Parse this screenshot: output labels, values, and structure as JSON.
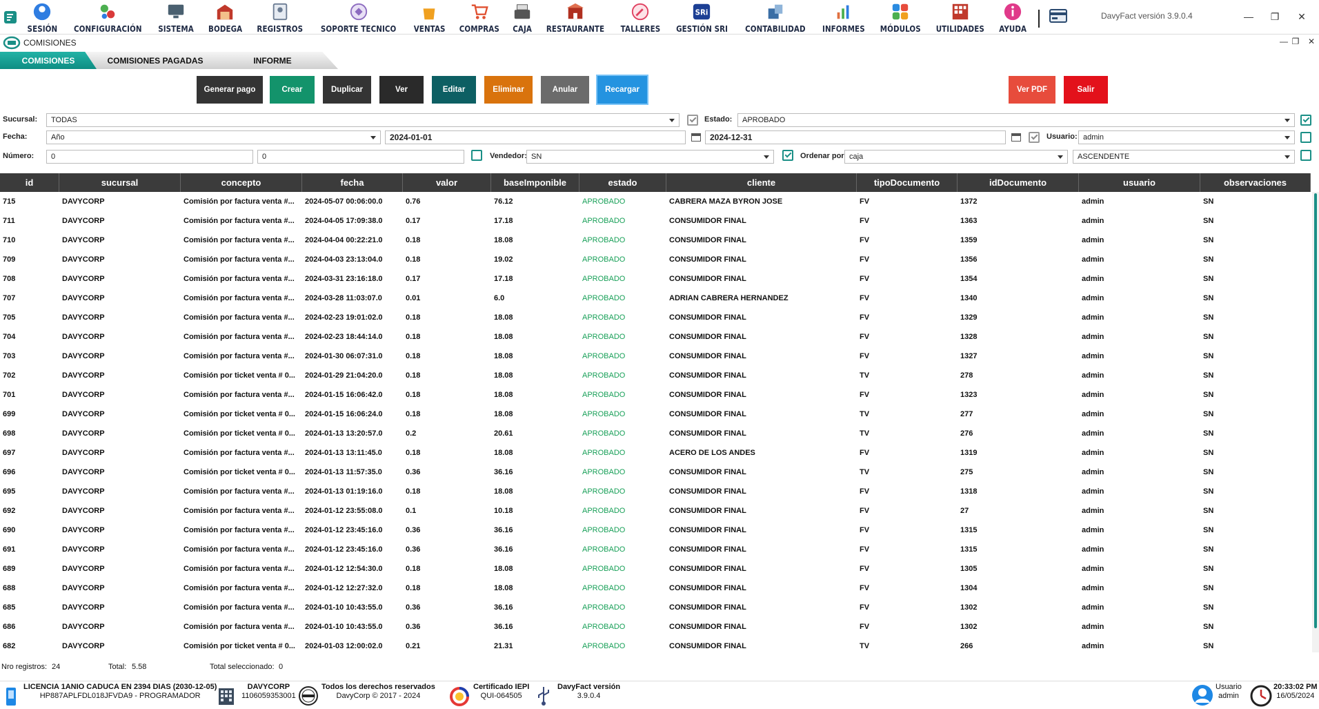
{
  "app": {
    "version_text": "DavyFact versión 3.9.0.4"
  },
  "menu": [
    {
      "label": "SESIÓN",
      "icon": "user-icon",
      "color": "#2f7de1"
    },
    {
      "label": "CONFIGURACIÓN",
      "icon": "gears-icon",
      "color": "#d93a3a"
    },
    {
      "label": "SISTEMA",
      "icon": "monitor-icon",
      "color": "#4a6070"
    },
    {
      "label": "BODEGA",
      "icon": "warehouse-icon",
      "color": "#c0392b"
    },
    {
      "label": "REGISTROS",
      "icon": "id-card-icon",
      "color": "#6b7c93"
    },
    {
      "label": "SOPORTE TECNICO",
      "icon": "support-icon",
      "color": "#8c6bbf"
    },
    {
      "label": "VENTAS",
      "icon": "shopping-bag-icon",
      "color": "#f0a020"
    },
    {
      "label": "COMPRAS",
      "icon": "cart-icon",
      "color": "#e05030"
    },
    {
      "label": "CAJA",
      "icon": "cash-register-icon",
      "color": "#555555"
    },
    {
      "label": "RESTAURANTE",
      "icon": "restaurant-icon",
      "color": "#b03020"
    },
    {
      "label": "TALLERES",
      "icon": "wrench-icon",
      "color": "#e04060"
    },
    {
      "label": "GESTIÓN SRI",
      "icon": "sri-icon",
      "color": "#1c3f94"
    },
    {
      "label": "CONTABILIDAD",
      "icon": "accounting-icon",
      "color": "#3a6ea5"
    },
    {
      "label": "INFORMES",
      "icon": "bar-chart-icon",
      "color": "#e07040"
    },
    {
      "label": "MÓDULOS",
      "icon": "modules-icon",
      "color": "#2a8be0"
    },
    {
      "label": "UTILIDADES",
      "icon": "utilities-icon",
      "color": "#c0392b"
    },
    {
      "label": "AYUDA",
      "icon": "help-icon",
      "color": "#e03a8a"
    }
  ],
  "window": {
    "title": "COMISIONES"
  },
  "tabs": [
    {
      "label": "COMISIONES",
      "active": true
    },
    {
      "label": "COMISIONES PAGADAS",
      "active": false
    },
    {
      "label": "INFORME",
      "active": false
    }
  ],
  "buttons": {
    "generar_pago": "Generar pago",
    "crear": "Crear",
    "duplicar": "Duplicar",
    "ver": "Ver",
    "editar": "Editar",
    "eliminar": "Eliminar",
    "anular": "Anular",
    "recargar": "Recargar",
    "ver_pdf": "Ver PDF",
    "salir": "Salir"
  },
  "filters": {
    "sucursal_label": "Sucursal:",
    "sucursal_value": "TODAS",
    "estado_label": "Estado:",
    "estado_value": "APROBADO",
    "fecha_label": "Fecha:",
    "fecha_value": "Año",
    "fecha_desde": "2024-01-01",
    "fecha_hasta": "2024-12-31",
    "usuario_label": "Usuario:",
    "usuario_value": "admin",
    "numero_label": "Número:",
    "numero_desde": "0",
    "numero_hasta": "0",
    "vendedor_label": "Vendedor:",
    "vendedor_value": "SN",
    "ordenar_label": "Ordenar por:",
    "ordenar_value": "caja",
    "orden_value": "ASCENDENTE"
  },
  "table": {
    "columns": [
      "id",
      "sucursal",
      "concepto",
      "fecha",
      "valor",
      "baseImponible",
      "estado",
      "cliente",
      "tipoDocumento",
      "idDocumento",
      "usuario",
      "observaciones"
    ],
    "rows": [
      [
        "715",
        "DAVYCORP",
        "Comisión por factura venta #...",
        "2024-05-07 00:06:00.0",
        "0.76",
        "76.12",
        "APROBADO",
        "CABRERA MAZA BYRON JOSE",
        "FV",
        "1372",
        "admin",
        "SN"
      ],
      [
        "711",
        "DAVYCORP",
        "Comisión por factura venta #...",
        "2024-04-05 17:09:38.0",
        "0.17",
        "17.18",
        "APROBADO",
        "CONSUMIDOR FINAL",
        "FV",
        "1363",
        "admin",
        "SN"
      ],
      [
        "710",
        "DAVYCORP",
        "Comisión por factura venta #...",
        "2024-04-04 00:22:21.0",
        "0.18",
        "18.08",
        "APROBADO",
        "CONSUMIDOR FINAL",
        "FV",
        "1359",
        "admin",
        "SN"
      ],
      [
        "709",
        "DAVYCORP",
        "Comisión por factura venta #...",
        "2024-04-03 23:13:04.0",
        "0.18",
        "19.02",
        "APROBADO",
        "CONSUMIDOR FINAL",
        "FV",
        "1356",
        "admin",
        "SN"
      ],
      [
        "708",
        "DAVYCORP",
        "Comisión por factura venta #...",
        "2024-03-31 23:16:18.0",
        "0.17",
        "17.18",
        "APROBADO",
        "CONSUMIDOR FINAL",
        "FV",
        "1354",
        "admin",
        "SN"
      ],
      [
        "707",
        "DAVYCORP",
        "Comisión por factura venta #...",
        "2024-03-28 11:03:07.0",
        "0.01",
        "6.0",
        "APROBADO",
        "ADRIAN CABRERA HERNANDEZ",
        "FV",
        "1340",
        "admin",
        "SN"
      ],
      [
        "705",
        "DAVYCORP",
        "Comisión por factura venta #...",
        "2024-02-23 19:01:02.0",
        "0.18",
        "18.08",
        "APROBADO",
        "CONSUMIDOR FINAL",
        "FV",
        "1329",
        "admin",
        "SN"
      ],
      [
        "704",
        "DAVYCORP",
        "Comisión por factura venta #...",
        "2024-02-23 18:44:14.0",
        "0.18",
        "18.08",
        "APROBADO",
        "CONSUMIDOR FINAL",
        "FV",
        "1328",
        "admin",
        "SN"
      ],
      [
        "703",
        "DAVYCORP",
        "Comisión por factura venta #...",
        "2024-01-30 06:07:31.0",
        "0.18",
        "18.08",
        "APROBADO",
        "CONSUMIDOR FINAL",
        "FV",
        "1327",
        "admin",
        "SN"
      ],
      [
        "702",
        "DAVYCORP",
        "Comisión por ticket venta # 0...",
        "2024-01-29 21:04:20.0",
        "0.18",
        "18.08",
        "APROBADO",
        "CONSUMIDOR FINAL",
        "TV",
        "278",
        "admin",
        "SN"
      ],
      [
        "701",
        "DAVYCORP",
        "Comisión por factura venta #...",
        "2024-01-15 16:06:42.0",
        "0.18",
        "18.08",
        "APROBADO",
        "CONSUMIDOR FINAL",
        "FV",
        "1323",
        "admin",
        "SN"
      ],
      [
        "699",
        "DAVYCORP",
        "Comisión por ticket venta # 0...",
        "2024-01-15 16:06:24.0",
        "0.18",
        "18.08",
        "APROBADO",
        "CONSUMIDOR FINAL",
        "TV",
        "277",
        "admin",
        "SN"
      ],
      [
        "698",
        "DAVYCORP",
        "Comisión por ticket venta # 0...",
        "2024-01-13 13:20:57.0",
        "0.2",
        "20.61",
        "APROBADO",
        "CONSUMIDOR FINAL",
        "TV",
        "276",
        "admin",
        "SN"
      ],
      [
        "697",
        "DAVYCORP",
        "Comisión por factura venta #...",
        "2024-01-13 13:11:45.0",
        "0.18",
        "18.08",
        "APROBADO",
        "ACERO DE LOS ANDES",
        "FV",
        "1319",
        "admin",
        "SN"
      ],
      [
        "696",
        "DAVYCORP",
        "Comisión por ticket venta # 0...",
        "2024-01-13 11:57:35.0",
        "0.36",
        "36.16",
        "APROBADO",
        "CONSUMIDOR FINAL",
        "TV",
        "275",
        "admin",
        "SN"
      ],
      [
        "695",
        "DAVYCORP",
        "Comisión por factura venta #...",
        "2024-01-13 01:19:16.0",
        "0.18",
        "18.08",
        "APROBADO",
        "CONSUMIDOR FINAL",
        "FV",
        "1318",
        "admin",
        "SN"
      ],
      [
        "692",
        "DAVYCORP",
        "Comisión por factura venta #...",
        "2024-01-12 23:55:08.0",
        "0.1",
        "10.18",
        "APROBADO",
        "CONSUMIDOR FINAL",
        "FV",
        "27",
        "admin",
        "SN"
      ],
      [
        "690",
        "DAVYCORP",
        "Comisión por factura venta #...",
        "2024-01-12 23:45:16.0",
        "0.36",
        "36.16",
        "APROBADO",
        "CONSUMIDOR FINAL",
        "FV",
        "1315",
        "admin",
        "SN"
      ],
      [
        "691",
        "DAVYCORP",
        "Comisión por factura venta #...",
        "2024-01-12 23:45:16.0",
        "0.36",
        "36.16",
        "APROBADO",
        "CONSUMIDOR FINAL",
        "FV",
        "1315",
        "admin",
        "SN"
      ],
      [
        "689",
        "DAVYCORP",
        "Comisión por factura venta #...",
        "2024-01-12 12:54:30.0",
        "0.18",
        "18.08",
        "APROBADO",
        "CONSUMIDOR FINAL",
        "FV",
        "1305",
        "admin",
        "SN"
      ],
      [
        "688",
        "DAVYCORP",
        "Comisión por factura venta #...",
        "2024-01-12 12:27:32.0",
        "0.18",
        "18.08",
        "APROBADO",
        "CONSUMIDOR FINAL",
        "FV",
        "1304",
        "admin",
        "SN"
      ],
      [
        "685",
        "DAVYCORP",
        "Comisión por factura venta #...",
        "2024-01-10 10:43:55.0",
        "0.36",
        "36.16",
        "APROBADO",
        "CONSUMIDOR FINAL",
        "FV",
        "1302",
        "admin",
        "SN"
      ],
      [
        "686",
        "DAVYCORP",
        "Comisión por factura venta #...",
        "2024-01-10 10:43:55.0",
        "0.36",
        "36.16",
        "APROBADO",
        "CONSUMIDOR FINAL",
        "FV",
        "1302",
        "admin",
        "SN"
      ],
      [
        "682",
        "DAVYCORP",
        "Comisión por ticket venta # 0...",
        "2024-01-03 12:00:02.0",
        "0.21",
        "21.31",
        "APROBADO",
        "CONSUMIDOR FINAL",
        "TV",
        "266",
        "admin",
        "SN"
      ]
    ]
  },
  "totals": {
    "nro_label": "Nro registros:",
    "nro_value": "24",
    "total_label": "Total:",
    "total_value": "5.58",
    "sel_label": "Total seleccionado:",
    "sel_value": "0"
  },
  "status": {
    "license_line1": "LICENCIA 1ANIO CADUCA EN 2394 DIAS (2030-12-05)",
    "license_line2": "HP887APLFDL018JFVDA9 - PROGRAMADOR",
    "company_name": "DAVYCORP",
    "company_ruc": "1106059353001",
    "rights_line1": "Todos los derechos reservados",
    "rights_line2": "DavyCorp © 2017 - 2024",
    "cert_line1": "Certificado IEPI",
    "cert_line2": "QUI-064505",
    "app_line1": "DavyFact versión",
    "app_line2": "3.9.0.4",
    "user_line1": "Usuario",
    "user_line2": "admin",
    "time": "20:33:02 PM",
    "date": "16/05/2024"
  }
}
